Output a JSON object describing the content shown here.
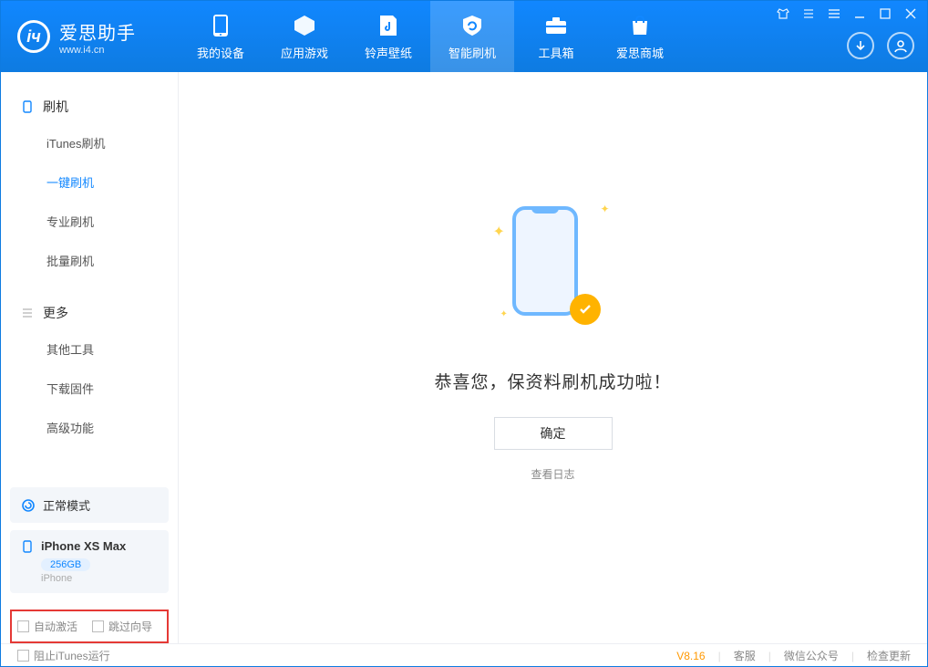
{
  "app": {
    "name": "爱思助手",
    "url": "www.i4.cn"
  },
  "tabs": [
    {
      "label": "我的设备"
    },
    {
      "label": "应用游戏"
    },
    {
      "label": "铃声壁纸"
    },
    {
      "label": "智能刷机"
    },
    {
      "label": "工具箱"
    },
    {
      "label": "爱思商城"
    }
  ],
  "sidebar": {
    "group1": {
      "title": "刷机",
      "items": [
        "iTunes刷机",
        "一键刷机",
        "专业刷机",
        "批量刷机"
      ]
    },
    "group2": {
      "title": "更多",
      "items": [
        "其他工具",
        "下载固件",
        "高级功能"
      ]
    }
  },
  "device": {
    "mode": "正常模式",
    "name": "iPhone XS Max",
    "capacity": "256GB",
    "type": "iPhone"
  },
  "options": {
    "auto_activate": "自动激活",
    "skip_guide": "跳过向导"
  },
  "main": {
    "success": "恭喜您，保资料刷机成功啦！",
    "ok": "确定",
    "view_log": "查看日志"
  },
  "footer": {
    "block_itunes": "阻止iTunes运行",
    "version": "V8.16",
    "links": [
      "客服",
      "微信公众号",
      "检查更新"
    ]
  }
}
